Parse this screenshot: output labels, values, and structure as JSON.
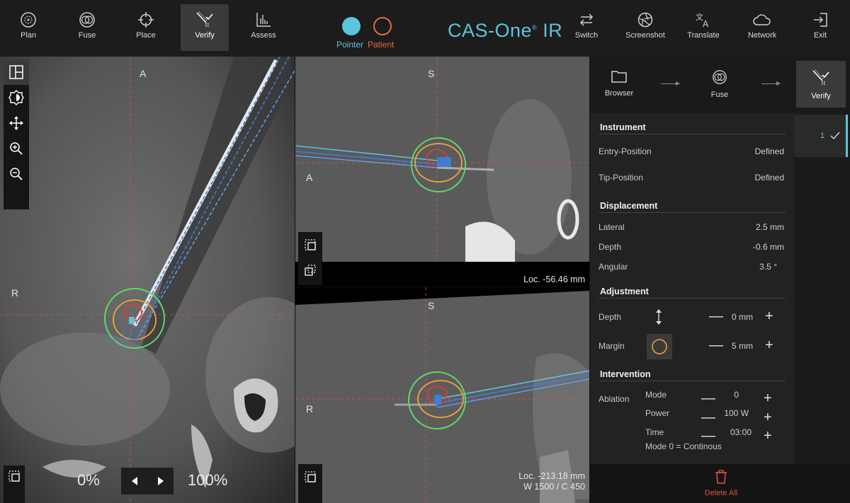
{
  "toolbar": {
    "items": [
      {
        "label": "Plan",
        "icon": "target-circle-icon"
      },
      {
        "label": "Fuse",
        "icon": "fuse-circles-icon"
      },
      {
        "label": "Place",
        "icon": "crosshair-icon"
      },
      {
        "label": "Verify",
        "icon": "verify-needle-icon",
        "active": true
      },
      {
        "label": "Assess",
        "icon": "bar-chart-icon"
      }
    ],
    "right_items": [
      {
        "label": "Switch",
        "icon": "swap-arrows-icon"
      },
      {
        "label": "Screenshot",
        "icon": "aperture-icon"
      },
      {
        "label": "Translate",
        "icon": "translate-icon"
      },
      {
        "label": "Network",
        "icon": "cloud-icon"
      },
      {
        "label": "Exit",
        "icon": "exit-icon"
      }
    ],
    "pointer_label": "Pointer",
    "patient_label": "Patient",
    "brand": "CAS-One",
    "brand_mark": "®",
    "brand_suffix": "IR"
  },
  "colors": {
    "accent": "#5ec3dd",
    "pointer": "#5ec3dd",
    "patient": "#e06a4e",
    "delete": "#e0503a",
    "zone_green": "#5fd86a",
    "zone_orange": "#f0a43a",
    "zone_red": "#e03a3a",
    "needle_blue": "#3a7fe0"
  },
  "views": {
    "axial": {
      "top": "A",
      "left": "R"
    },
    "coronal": {
      "top": "S",
      "left": "A",
      "loc": "Loc. -56.46 mm"
    },
    "sagittal": {
      "top": "S",
      "left": "R",
      "loc": "Loc. -213.18 mm",
      "window": "W 1500 / C 450"
    }
  },
  "zoom": {
    "min_label": "0%",
    "max_label": "100%"
  },
  "workflow": {
    "items": [
      {
        "label": "Browser",
        "icon": "folder-icon"
      },
      {
        "label": "Fuse",
        "icon": "fuse-circles-icon"
      },
      {
        "label": "Verify",
        "icon": "verify-needle-icon",
        "active": true
      }
    ],
    "step": "1"
  },
  "instrument": {
    "title": "Instrument",
    "entry_label": "Entry-Position",
    "entry_value": "Defined",
    "tip_label": "Tip-Position",
    "tip_value": "Defined"
  },
  "displacement": {
    "title": "Displacement",
    "lateral_label": "Lateral",
    "lateral_value": "2.5 mm",
    "depth_label": "Depth",
    "depth_value": "-0.6 mm",
    "angular_label": "Angular",
    "angular_value": "3.5 °"
  },
  "adjustment": {
    "title": "Adjustment",
    "depth_label": "Depth",
    "depth_value": "0 mm",
    "margin_label": "Margin",
    "margin_value": "5 mm"
  },
  "intervention": {
    "title": "Intervention",
    "ablation_label": "Ablation",
    "mode_label": "Mode",
    "mode_value": "0",
    "power_label": "Power",
    "power_value": "100 W",
    "time_label": "Time",
    "time_value": "03:00",
    "note": "Mode 0 = Continous"
  },
  "delete_all": "Delete All"
}
